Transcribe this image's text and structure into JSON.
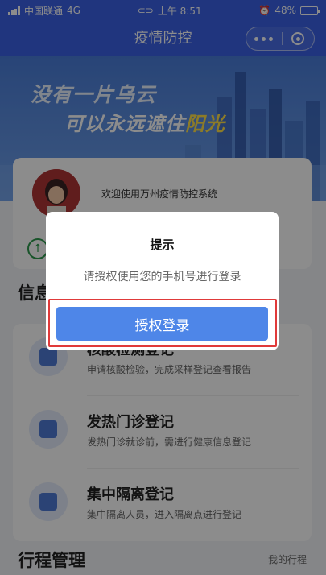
{
  "status_bar": {
    "carrier": "中国联通",
    "network": "4G",
    "time": "上午 8:51",
    "battery": "48%",
    "battery_level": 0.48
  },
  "nav": {
    "title": "疫情防控"
  },
  "banner": {
    "line1": "没有一片乌云",
    "line2_prefix": "可以永远遮住",
    "line2_highlight": "阳光",
    "colors": {
      "highlight": "#ffe14a"
    }
  },
  "user_card": {
    "welcome": "欢迎使用万州疫情防控系统"
  },
  "sections": {
    "info_title_partial": "信息",
    "trip_title": "行程管理",
    "trip_link": "我的行程"
  },
  "services": [
    {
      "name": "核酸检测登记",
      "desc": "申请核酸检验，完成采样登记查看报告",
      "icon": "network-icon"
    },
    {
      "name": "发热门诊登记",
      "desc": "发热门诊就诊前，需进行健康信息登记",
      "icon": "medical-plus-icon"
    },
    {
      "name": "集中隔离登记",
      "desc": "集中隔离人员，进入隔离点进行登记",
      "icon": "clipboard-icon"
    }
  ],
  "dialog": {
    "title": "提示",
    "message": "请授权使用您的手机号进行登录",
    "button": "授权登录"
  },
  "colors": {
    "primary": "#3b62e6",
    "button": "#4e86e8",
    "highlight_frame": "#e03a3a"
  }
}
